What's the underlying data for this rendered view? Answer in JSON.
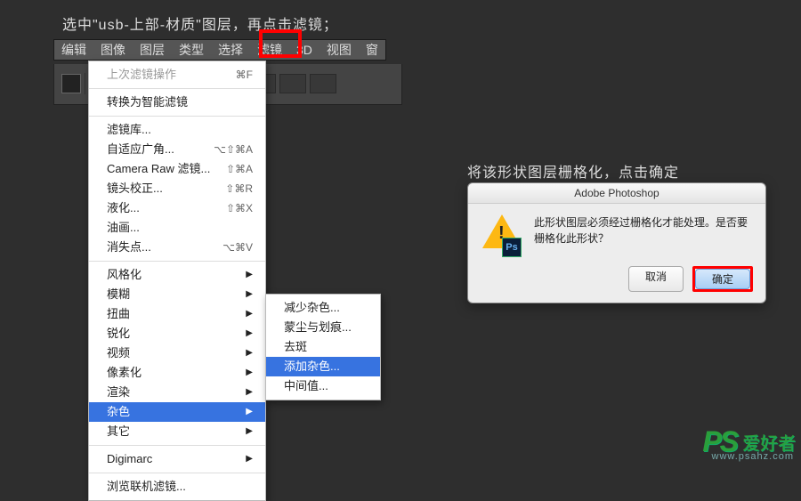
{
  "caption1": "选中\"usb-上部-材质\"图层，再点击滤镜；",
  "caption2": "将该形状图层栅格化，点击确定",
  "menubar": {
    "edit": "编辑",
    "image": "图像",
    "layer": "图层",
    "type": "类型",
    "select": "选择",
    "filter": "滤镜",
    "three_d": "3D",
    "view": "视图",
    "window": "窗"
  },
  "menu1": {
    "last_filter": {
      "label": "上次滤镜操作",
      "shortcut": "⌘F"
    },
    "convert_smart": {
      "label": "转换为智能滤镜"
    },
    "filter_gallery": {
      "label": "滤镜库..."
    },
    "adaptive_wide": {
      "label": "自适应广角...",
      "shortcut": "⌥⇧⌘A"
    },
    "camera_raw": {
      "label": "Camera Raw 滤镜...",
      "shortcut": "⇧⌘A"
    },
    "lens_correction": {
      "label": "镜头校正...",
      "shortcut": "⇧⌘R"
    },
    "liquify": {
      "label": "液化...",
      "shortcut": "⇧⌘X"
    },
    "oil_paint": {
      "label": "油画..."
    },
    "vanishing_point": {
      "label": "消失点...",
      "shortcut": "⌥⌘V"
    },
    "stylize": {
      "label": "风格化"
    },
    "blur": {
      "label": "模糊"
    },
    "distort": {
      "label": "扭曲"
    },
    "sharpen": {
      "label": "锐化"
    },
    "video": {
      "label": "视频"
    },
    "pixelate": {
      "label": "像素化"
    },
    "render": {
      "label": "渲染"
    },
    "noise": {
      "label": "杂色"
    },
    "other": {
      "label": "其它"
    },
    "digimarc": {
      "label": "Digimarc"
    },
    "browse_online": {
      "label": "浏览联机滤镜..."
    }
  },
  "menu2": {
    "reduce_noise": {
      "label": "减少杂色..."
    },
    "dust_scratches": {
      "label": "蒙尘与划痕..."
    },
    "despeckle": {
      "label": "去斑"
    },
    "add_noise": {
      "label": "添加杂色..."
    },
    "median": {
      "label": "中间值..."
    }
  },
  "dialog": {
    "title": "Adobe Photoshop",
    "message": "此形状图层必须经过栅格化才能处理。是否要栅格化此形状？",
    "cancel": "取消",
    "ok": "确定",
    "ps": "Ps"
  },
  "watermark": {
    "logo": "PS",
    "text": "爱好者",
    "url": "www.psahz.com"
  }
}
